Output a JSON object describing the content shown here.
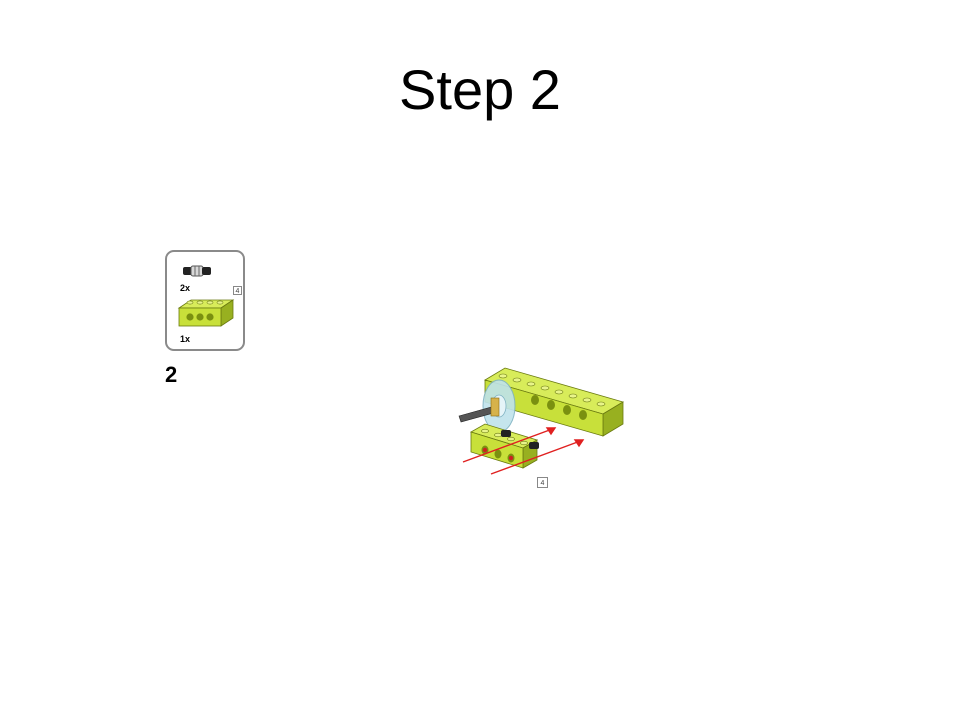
{
  "slide": {
    "title": "Step 2"
  },
  "step": {
    "number": "2"
  },
  "parts_list": {
    "items": [
      {
        "part": "axle-connector",
        "quantity": "2x"
      },
      {
        "part": "beam-4",
        "quantity": "1x",
        "length_tag": "4"
      }
    ]
  },
  "assembly": {
    "length_tag": "4"
  },
  "colors": {
    "lego_lime": "#c8e03a",
    "lego_lime_dark": "#98b020",
    "arrow_red": "#e02020",
    "wheel_blue": "#bfe3ec"
  }
}
